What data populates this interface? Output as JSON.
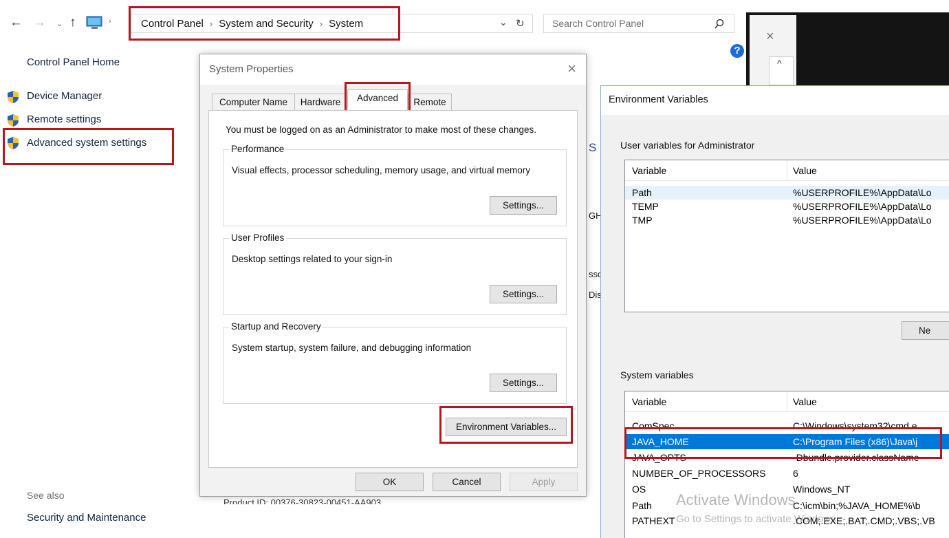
{
  "explorer": {
    "breadcrumb": [
      "Control Panel",
      "System and Security",
      "System"
    ],
    "search_placeholder": "Search Control Panel",
    "left_nav": {
      "home": "Control Panel Home",
      "items": [
        "Device Manager",
        "Remote settings",
        "Advanced system settings"
      ],
      "see_also_label": "See also",
      "see_also_items": [
        "Security and Maintenance"
      ]
    },
    "partial_text": {
      "s": "S",
      "gh": "GH",
      "sso": "sso",
      "dis": "Dis",
      "product_id": "Product ID: 00376-30823-00451-AA903"
    }
  },
  "system_properties": {
    "title": "System Properties",
    "tabs": [
      "Computer Name",
      "Hardware",
      "Advanced",
      "Remote"
    ],
    "active_tab": "Advanced",
    "admin_note": "You must be logged on as an Administrator to make most of these changes.",
    "groups": [
      {
        "title": "Performance",
        "desc": "Visual effects, processor scheduling, memory usage, and virtual memory",
        "button": "Settings..."
      },
      {
        "title": "User Profiles",
        "desc": "Desktop settings related to your sign-in",
        "button": "Settings..."
      },
      {
        "title": "Startup and Recovery",
        "desc": "System startup, system failure, and debugging information",
        "button": "Settings..."
      }
    ],
    "env_button": "Environment Variables...",
    "buttons": {
      "ok": "OK",
      "cancel": "Cancel",
      "apply": "Apply"
    }
  },
  "environment_variables": {
    "title": "Environment Variables",
    "user_section": "User variables for Administrator",
    "system_section": "System variables",
    "col_variable": "Variable",
    "col_value": "Value",
    "user_vars": [
      {
        "name": "Path",
        "value": "%USERPROFILE%\\AppData\\Lo"
      },
      {
        "name": "TEMP",
        "value": "%USERPROFILE%\\AppData\\Lo"
      },
      {
        "name": "TMP",
        "value": "%USERPROFILE%\\AppData\\Lo"
      }
    ],
    "user_new_button": "Ne",
    "system_vars": [
      {
        "name": "ComSpec",
        "value": "C:\\Windows\\system32\\cmd.e"
      },
      {
        "name": "JAVA_HOME",
        "value": "C:\\Program Files (x86)\\Java\\j"
      },
      {
        "name": "JAVA_OPTS",
        "value": "-Dbundle.provider.className"
      },
      {
        "name": "NUMBER_OF_PROCESSORS",
        "value": "6"
      },
      {
        "name": "OS",
        "value": "Windows_NT"
      },
      {
        "name": "Path",
        "value": "C:\\icm\\bin;%JAVA_HOME%\\b"
      },
      {
        "name": "PATHEXT",
        "value": ".COM;.EXE;.BAT;.CMD;.VBS;.VB"
      }
    ],
    "selected_variable": "JAVA_HOME"
  },
  "watermark": {
    "line1": "Activate Windows",
    "line2": "Go to Settings to activate Windows."
  },
  "colors": {
    "highlight_box": "#b4161b",
    "selection": "#0078d7",
    "help_badge": "#1c6bd6"
  }
}
